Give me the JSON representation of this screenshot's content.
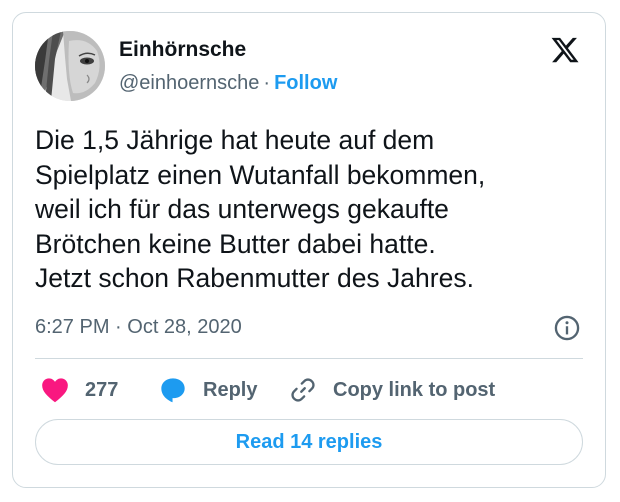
{
  "author": {
    "display_name": "Einhörnsche",
    "handle": "@einhoernsche",
    "separator": "·",
    "follow_label": "Follow"
  },
  "tweet": {
    "lines": [
      "Die 1,5 Jährige hat heute auf dem",
      "Spielplatz einen Wutanfall bekommen,",
      "weil ich für das unterwegs gekaufte",
      "Brötchen keine Butter dabei hatte.",
      "Jetzt schon Rabenmutter des Jahres."
    ],
    "timestamp": "6:27 PM · Oct 28, 2020"
  },
  "actions": {
    "like_count": "277",
    "reply_label": "Reply",
    "copy_link_label": "Copy link to post"
  },
  "read_replies_label": "Read 14 replies",
  "icons": {
    "logo": "x-logo-icon",
    "info": "info-icon",
    "like": "heart-icon",
    "reply": "speech-bubble-icon",
    "copy": "link-icon"
  },
  "colors": {
    "accent": "#1d9bf0",
    "like": "#f91880",
    "text": "#0f1419",
    "secondary": "#536471",
    "border": "#cfd9de"
  }
}
